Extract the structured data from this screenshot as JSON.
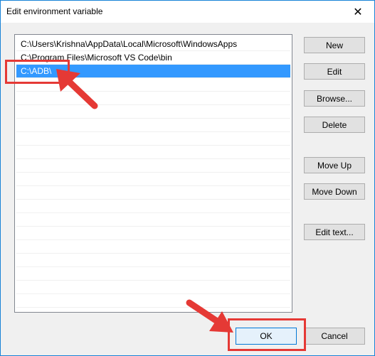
{
  "window": {
    "title": "Edit environment variable",
    "close_glyph": "✕"
  },
  "list": {
    "items": [
      {
        "label": "C:\\Users\\Krishna\\AppData\\Local\\Microsoft\\WindowsApps",
        "selected": false
      },
      {
        "label": "C:\\Program Files\\Microsoft VS Code\\bin",
        "selected": false
      },
      {
        "label": "C:\\ADB\\",
        "selected": true
      }
    ]
  },
  "buttons": {
    "new": "New",
    "edit": "Edit",
    "browse": "Browse...",
    "delete": "Delete",
    "move_up": "Move Up",
    "move_down": "Move Down",
    "edit_text": "Edit text...",
    "ok": "OK",
    "cancel": "Cancel"
  },
  "colors": {
    "selection": "#3399ff",
    "annotation": "#e53935",
    "titlebar_border": "#1883d7"
  },
  "annotations": {
    "arrow_icon": "red-arrow",
    "highlight_icon": "red-box"
  }
}
